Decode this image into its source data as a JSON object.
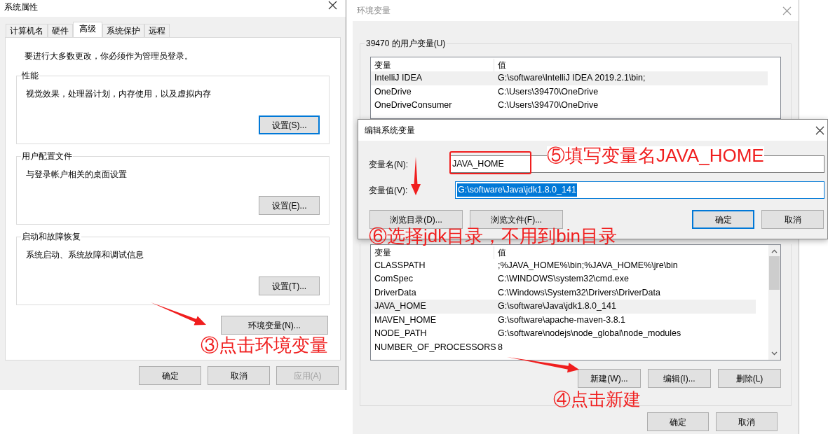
{
  "system_properties": {
    "title": "系统属性",
    "tabs": [
      {
        "label": "计算机名",
        "selected": false
      },
      {
        "label": "硬件",
        "selected": false
      },
      {
        "label": "高级",
        "selected": true
      },
      {
        "label": "系统保护",
        "selected": false
      },
      {
        "label": "远程",
        "selected": false
      }
    ],
    "notice": "要进行大多数更改，你必须作为管理员登录。",
    "groups": [
      {
        "title": "性能",
        "description": "视觉效果，处理器计划，内存使用，以及虚拟内存",
        "button": {
          "label": "设置(S)...",
          "default": true
        }
      },
      {
        "title": "用户配置文件",
        "description": "与登录帐户相关的桌面设置",
        "button": {
          "label": "设置(E)...",
          "default": false
        }
      },
      {
        "title": "启动和故障恢复",
        "description": "系统启动、系统故障和调试信息",
        "button": {
          "label": "设置(T)...",
          "default": false
        }
      }
    ],
    "env_button": "环境变量(N)...",
    "footer_buttons": [
      {
        "label": "确定",
        "disabled": false
      },
      {
        "label": "取消",
        "disabled": false
      },
      {
        "label": "应用(A)",
        "disabled": true
      }
    ]
  },
  "environment_variables": {
    "title": "环境变量",
    "user_group": "39470 的用户变量(U)",
    "user_table": {
      "columns": [
        "变量",
        "值"
      ],
      "rows": [
        {
          "cells": [
            "IntelliJ IDEA",
            "G:\\software\\IntelliJ IDEA 2019.2.1\\bin;"
          ],
          "selected": true
        },
        {
          "cells": [
            "OneDrive",
            "C:\\Users\\39470\\OneDrive"
          ],
          "selected": false
        },
        {
          "cells": [
            "OneDriveConsumer",
            "C:\\Users\\39470\\OneDrive"
          ],
          "selected": false
        }
      ]
    },
    "system_table": {
      "columns": [
        "变量",
        "值"
      ],
      "rows": [
        {
          "cells": [
            "CLASSPATH",
            ";%JAVA_HOME%\\bin;%JAVA_HOME%\\jre\\bin"
          ],
          "selected": false
        },
        {
          "cells": [
            "ComSpec",
            "C:\\WINDOWS\\system32\\cmd.exe"
          ],
          "selected": false
        },
        {
          "cells": [
            "DriverData",
            "C:\\Windows\\System32\\Drivers\\DriverData"
          ],
          "selected": false
        },
        {
          "cells": [
            "JAVA_HOME",
            "G:\\software\\Java\\jdk1.8.0_141"
          ],
          "selected": true
        },
        {
          "cells": [
            "MAVEN_HOME",
            "G:\\software\\apache-maven-3.8.1"
          ],
          "selected": false
        },
        {
          "cells": [
            "NODE_PATH",
            "G:\\software\\nodejs\\node_global\\node_modules"
          ],
          "selected": false
        },
        {
          "cells": [
            "NUMBER_OF_PROCESSORS",
            "8"
          ],
          "selected": false
        }
      ]
    },
    "system_buttons": [
      "新建(W)...",
      "编辑(I)...",
      "删除(L)"
    ],
    "footer_buttons": [
      "确定",
      "取消"
    ]
  },
  "edit_dialog": {
    "title": "编辑系统变量",
    "fields": [
      {
        "label": "变量名(N):",
        "value": "JAVA_HOME",
        "highlighted": false
      },
      {
        "label": "变量值(V):",
        "value": "G:\\software\\Java\\jdk1.8.0_141",
        "highlighted": true
      }
    ],
    "buttons": [
      {
        "label": "浏览目录(D)...",
        "default": false
      },
      {
        "label": "浏览文件(F)...",
        "default": false
      },
      {
        "label": "确定",
        "default": true
      },
      {
        "label": "取消",
        "default": false
      }
    ]
  },
  "annotations": [
    "⑤填写变量名JAVA_HOME",
    "⑥选择jdk目录，不用到bin目录",
    "③点击环境变量",
    "④点击新建"
  ]
}
